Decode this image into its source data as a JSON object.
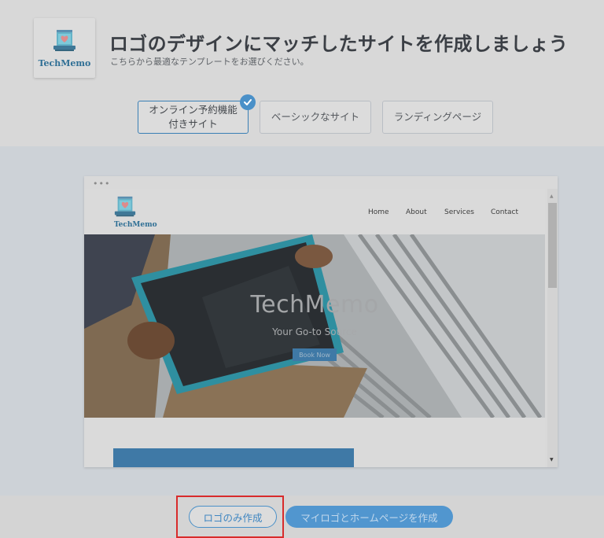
{
  "brand": {
    "name": "TechMemo"
  },
  "header": {
    "title": "ロゴのデザインにマッチしたサイトを作成しましょう",
    "subtitle": "こちらから最適なテンプレートをお選びください。"
  },
  "templates": [
    {
      "label_line1": "オンライン予約機能",
      "label_line2": "付きサイト",
      "selected": true
    },
    {
      "label": "ベーシックなサイト",
      "selected": false
    },
    {
      "label": "ランディングページ",
      "selected": false
    }
  ],
  "preview": {
    "window_dots": "•••",
    "nav": [
      "Home",
      "About",
      "Services",
      "Contact"
    ],
    "hero_title": "TechMemo",
    "hero_subtitle": "Your Go-to Source",
    "hero_button": "Book Now"
  },
  "actions": {
    "logo_only": "ロゴのみ作成",
    "logo_and_site": "マイロゴとホームページを作成"
  },
  "colors": {
    "accent": "#4a90c8",
    "brand_blue": "#2f6f95",
    "highlight_red": "#d82b2b"
  },
  "icons": [
    "laptop-heart-icon",
    "checkmark-icon",
    "scroll-up-icon",
    "scroll-down-icon"
  ]
}
